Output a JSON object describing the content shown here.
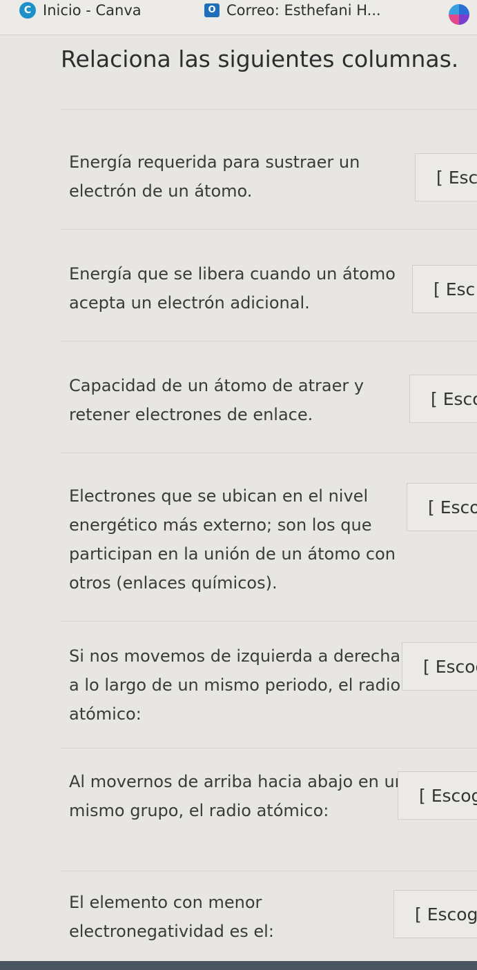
{
  "tabs": [
    {
      "label": "Inicio - Canva",
      "icon": "canva-icon"
    },
    {
      "label": "Correo: Esthefani H...",
      "icon": "outlook-icon"
    }
  ],
  "page_title": "Relaciona las siguientes columnas.",
  "questions": [
    {
      "text": "Energía requerida para sustraer un electrón de un átomo.",
      "select": "[ Esc"
    },
    {
      "text": "Energía que se libera cuando un átomo acepta un electrón adicional.",
      "select": "[ Esc"
    },
    {
      "text": "Capacidad de un átomo de atraer y retener electrones de enlace.",
      "select": "[ Esco"
    },
    {
      "text": "Electrones que se ubican en el nivel energético más externo; son los que participan en la unión de un átomo con otros (enlaces químicos).",
      "select": "[ Esco"
    },
    {
      "text": "Si nos movemos de izquierda a derecha a lo largo de un mismo periodo, el radio atómico:",
      "select": "[ Escog"
    },
    {
      "text": "Al movernos de arriba hacia abajo en un mismo grupo, el radio atómico:",
      "select": "[ Escog"
    },
    {
      "text": "El elemento con menor electronegatividad es el:",
      "select": "[ Escoge"
    }
  ]
}
